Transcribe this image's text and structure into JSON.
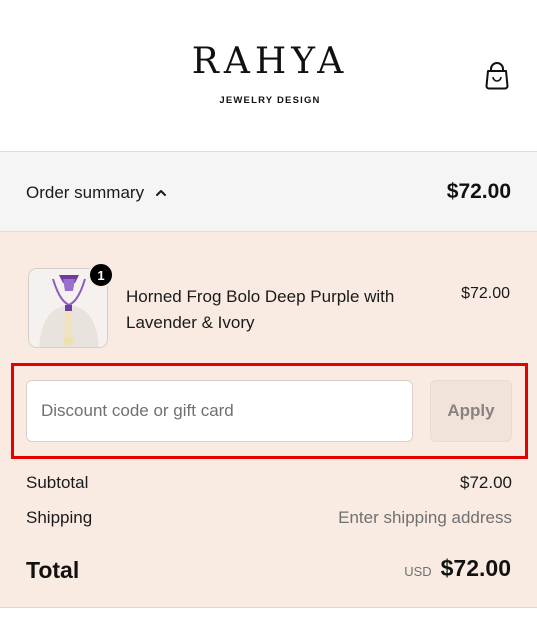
{
  "brand": {
    "name": "RAHYA",
    "tagline": "JEWELRY DESIGN"
  },
  "header": {
    "cart_icon": "shopping-bag-icon"
  },
  "summary": {
    "toggle_label": "Order summary",
    "toggle_icon": "chevron-up-icon",
    "total": "$72.00"
  },
  "items": [
    {
      "name": "Horned Frog Bolo Deep Purple with Lavender & Ivory",
      "price": "$72.00",
      "quantity": "1"
    }
  ],
  "discount": {
    "placeholder": "Discount code or gift card",
    "value": "",
    "apply_label": "Apply"
  },
  "totals": {
    "subtotal_label": "Subtotal",
    "subtotal_value": "$72.00",
    "shipping_label": "Shipping",
    "shipping_value": "Enter shipping address",
    "total_label": "Total",
    "currency": "USD",
    "total_value": "$72.00"
  },
  "colors": {
    "panel_bg": "#f9ebe2",
    "summary_bg": "#f5f5f5",
    "highlight": "#e60000",
    "product_accent": "#7b3fa8"
  }
}
